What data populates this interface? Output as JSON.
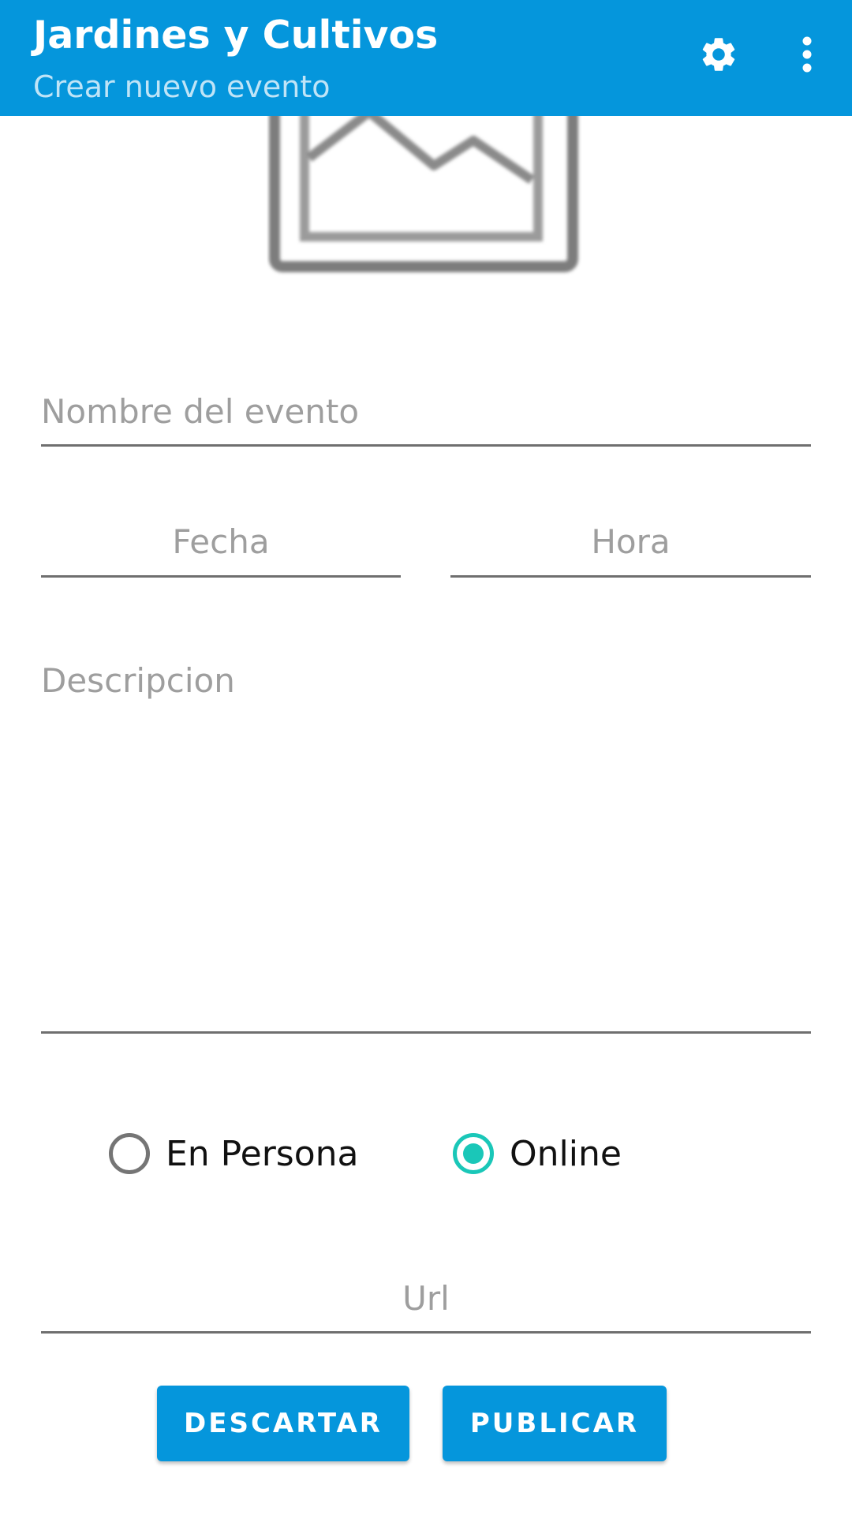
{
  "app_bar": {
    "title": "Jardines y Cultivos",
    "subtitle": "Crear nuevo evento",
    "background_color": "#0596dc",
    "actions": [
      {
        "icon": "gear-icon"
      },
      {
        "icon": "more-vert-icon"
      }
    ]
  },
  "image_placeholder": {
    "icon": "image-placeholder-icon"
  },
  "form": {
    "name_placeholder": "Nombre del evento",
    "date_placeholder": "Fecha",
    "time_placeholder": "Hora",
    "description_placeholder": "Descripcion",
    "url_placeholder": "Url",
    "modality": {
      "options": [
        {
          "label": "En Persona",
          "checked": false
        },
        {
          "label": "Online",
          "checked": true
        }
      ],
      "accent_color": "#1ac7b8"
    }
  },
  "buttons": {
    "discard_label": "DESCARTAR",
    "publish_label": "PUBLICAR"
  }
}
